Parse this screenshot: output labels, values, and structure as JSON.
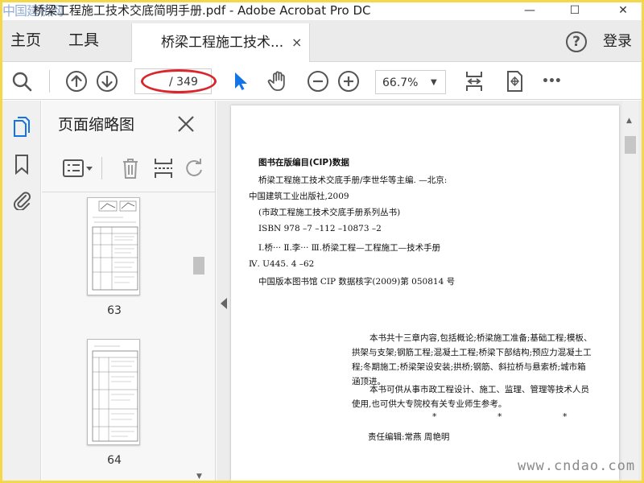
{
  "titlebar": {
    "watermark": "中国建桥网",
    "title": "桥梁工程施工技术交底简明手册.pdf - Adobe Acrobat Pro DC",
    "minimize": "—",
    "maximize": "☐",
    "close": "✕"
  },
  "tabbar": {
    "home": "主页",
    "tools": "工具",
    "doc_tab": "桥梁工程施工技术...",
    "doc_tab_close": "×",
    "help": "?",
    "login": "登录"
  },
  "toolbar": {
    "page_current": "",
    "page_total": "/ 349",
    "zoom": "66.7%",
    "more": "•••"
  },
  "sidebar": {
    "panel_title": "页面缩略图",
    "thumbnails": [
      {
        "label": "63"
      },
      {
        "label": "64"
      }
    ]
  },
  "document": {
    "cip_title": "图书在版编目(CIP)数据",
    "cip_lines": [
      "桥梁工程施工技术交底手册/李世华等主编. —北京:",
      "中国建筑工业出版社,2009",
      "(市政工程施工技术交底手册系列丛书)",
      "ISBN   978 –7 –112 –10873 –2",
      "Ⅰ.桥···   Ⅱ.李···   Ⅲ.桥梁工程—工程施工—技术手册",
      "Ⅳ. U445. 4 –62",
      "中国版本图书馆 CIP 数据核字(2009)第 050814 号"
    ],
    "summary_1": "本书共十三章内容,包括概论;桥梁施工准备;基础工程;模板、拱架与支架;钢筋工程;混凝土工程;桥梁下部结构;预应力混凝土工程;冬期施工;桥梁架设安装;拱桥;钢筋、斜拉桥与悬索桥;城市箱涵顶进。",
    "summary_2": "本书可供从事市政工程设计、施工、监理、管理等技术人员使用,也可供大专院校有关专业师生参考。",
    "stars": "* * *",
    "editor": "责任编辑:常燕  周艳明"
  },
  "watermark_site": "www.cndao.com",
  "colors": {
    "highlight": "#d8262c",
    "frame": "#f4d84a",
    "accent_blue": "#1473e6"
  }
}
